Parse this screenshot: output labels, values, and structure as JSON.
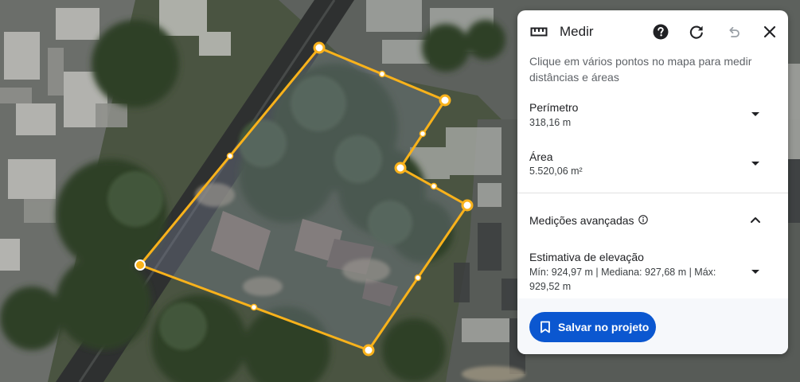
{
  "panel": {
    "title": "Medir",
    "instructions": "Clique em vários pontos no mapa para medir distâncias e áreas",
    "perimeter": {
      "label": "Perímetro",
      "value": "318,16 m"
    },
    "area": {
      "label": "Área",
      "value": "5.520,06 m²"
    },
    "advanced": {
      "label": "Medições avançadas"
    },
    "elevation": {
      "label": "Estimativa de elevação",
      "value": "Mín: 924,97 m | Mediana: 927,68 m | Máx: 929,52 m"
    },
    "save_label": "Salvar no projeto"
  },
  "icons": {
    "ruler": "ruler-icon",
    "help": "help-circle-icon",
    "reset": "refresh-icon",
    "undo": "undo-icon",
    "close": "close-icon",
    "info": "info-icon",
    "expand": "chevron-up-icon",
    "dropdown": "caret-down-icon",
    "bookmark": "bookmark-icon"
  },
  "colors": {
    "measure_line": "#f9b21b",
    "accent_button": "#0b57d0",
    "disabled_icon": "#9aa0a6"
  }
}
